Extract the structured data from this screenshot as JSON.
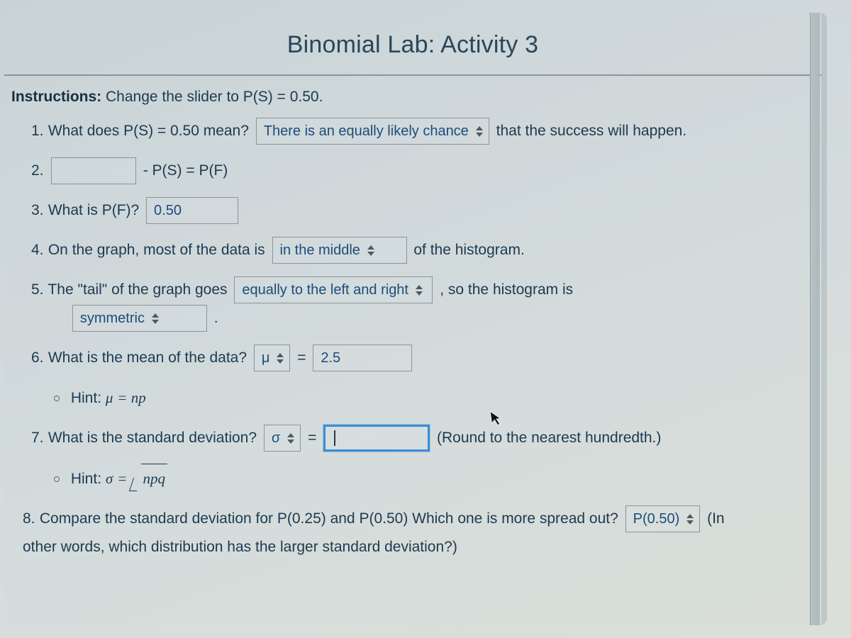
{
  "title": "Binomial Lab: Activity 3",
  "instructions_label": "Instructions:",
  "instructions_text": "Change the slider to P(S) = 0.50.",
  "q1": {
    "num": "1.",
    "text": "What does P(S) = 0.50 mean?",
    "select_value": "There is an equally likely chance",
    "after": "that the success will happen."
  },
  "q2": {
    "num": "2.",
    "input_value": "",
    "after": "- P(S) = P(F)"
  },
  "q3": {
    "num": "3.",
    "text": "What is P(F)?",
    "input_value": "0.50"
  },
  "q4": {
    "num": "4.",
    "text": "On the graph, most of the data is",
    "select_value": "in the middle",
    "after": "of the histogram."
  },
  "q5": {
    "num": "5.",
    "text_a": "The \"tail\" of the graph goes",
    "select_a": "equally to the left and right",
    "mid": ", so the histogram is",
    "select_b": "symmetric",
    "end": "."
  },
  "q6": {
    "num": "6.",
    "text": "What is the mean of the data?",
    "symbol_select": "μ",
    "eq": "=",
    "value": "2.5",
    "hint_label": "Hint:",
    "hint_formula_lhs": "μ",
    "hint_formula_rhs": "np"
  },
  "q7": {
    "num": "7.",
    "text": "What is the standard deviation?",
    "symbol_select": "σ",
    "eq": "=",
    "value": "",
    "after": "(Round to the nearest hundredth.)",
    "hint_label": "Hint:",
    "hint_formula_lhs": "σ",
    "hint_formula_rhs": "npq"
  },
  "q8": {
    "num": "8.",
    "text_a": "Compare the standard deviation for P(0.25) and P(0.50) Which one is more spread out?",
    "select_value": "P(0.50)",
    "after_a": "(In",
    "text_b": "other words, which distribution has the larger standard deviation?)"
  }
}
